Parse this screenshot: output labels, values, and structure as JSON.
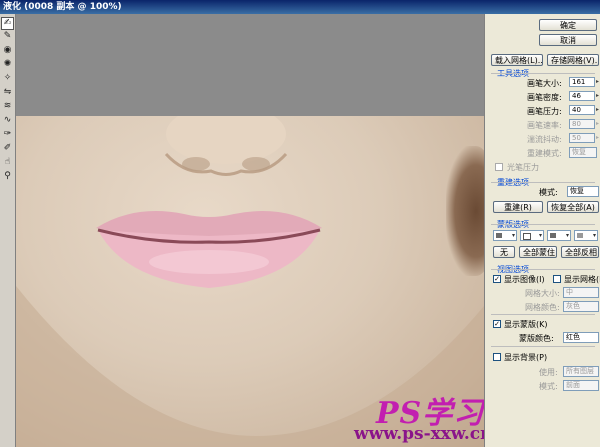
{
  "window": {
    "title": "液化 (0008 副本 @ 100%)"
  },
  "tools": [
    {
      "icon": "forward-warp-icon",
      "glyph": "✍"
    },
    {
      "icon": "reconstruct-icon",
      "glyph": "✎"
    },
    {
      "icon": "twirl-clockwise-icon",
      "glyph": "◉"
    },
    {
      "icon": "pucker-icon",
      "glyph": "✺"
    },
    {
      "icon": "bloat-icon",
      "glyph": "✧"
    },
    {
      "icon": "push-left-icon",
      "glyph": "⇋"
    },
    {
      "icon": "mirror-icon",
      "glyph": "≋"
    },
    {
      "icon": "turbulence-icon",
      "glyph": "∿"
    },
    {
      "icon": "freeze-mask-icon",
      "glyph": "✑"
    },
    {
      "icon": "thaw-mask-icon",
      "glyph": "✐"
    },
    {
      "icon": "hand-icon",
      "glyph": "☝"
    },
    {
      "icon": "zoom-icon",
      "glyph": "⚲"
    }
  ],
  "buttons": {
    "ok": "确定",
    "cancel": "取消",
    "load_mesh": "载入网格(L)...",
    "save_mesh": "存储网格(V)..."
  },
  "tool_options": {
    "title": "工具选项",
    "brush_size": {
      "label": "画笔大小:",
      "value": "161"
    },
    "brush_density": {
      "label": "画笔密度:",
      "value": "46"
    },
    "brush_pressure": {
      "label": "画笔压力:",
      "value": "40"
    },
    "brush_rate": {
      "label": "画笔速率:",
      "value": "80"
    },
    "turbulent_jitter": {
      "label": "湍流抖动:",
      "value": "50"
    },
    "reconstruct_mode": {
      "label": "重建模式:",
      "value": "恢复"
    },
    "stylus_pressure": "光笔压力"
  },
  "reconstruct_options": {
    "title": "重建选项",
    "mode_label": "模式:",
    "mode_value": "恢复",
    "reconstruct_button": "重建(R)",
    "restore_all_button": "恢复全部(A)"
  },
  "mask_options": {
    "title": "蒙版选项",
    "none_button": "无",
    "mask_all_button": "全部蒙住",
    "invert_all_button": "全部反相"
  },
  "view_options": {
    "title": "视图选项",
    "show_image": "显示图像(I)",
    "show_mesh": "显示网格(E)",
    "mesh_size": {
      "label": "网格大小:",
      "value": "中"
    },
    "mesh_color": {
      "label": "网格颜色:",
      "value": "灰色"
    },
    "show_mask": "显示蒙版(K)",
    "mask_color": {
      "label": "蒙版颜色:",
      "value": "红色"
    },
    "show_backdrop": "显示背景(P)",
    "use": {
      "label": "使用:",
      "value": "所有图层"
    },
    "mode": {
      "label": "模式:",
      "value": "前面"
    }
  },
  "watermark": {
    "logo": "PS学习网",
    "url": "www.ps-xxw.cn"
  }
}
